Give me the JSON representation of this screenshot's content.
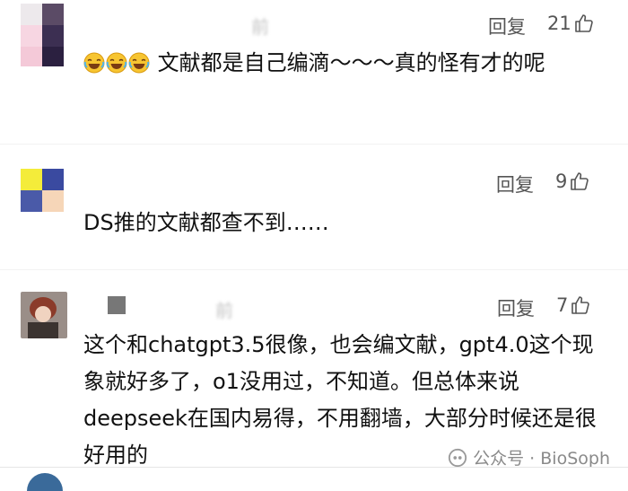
{
  "comments": [
    {
      "author": "",
      "time_fragment": "前",
      "reply_label": "回复",
      "likes": "21",
      "text": "文献都是自己编滴～～～真的怪有才的呢",
      "emoji_count": 3
    },
    {
      "author": "",
      "time_fragment": "",
      "reply_label": "回复",
      "likes": "9",
      "text": "DS推的文献都查不到……"
    },
    {
      "author": "",
      "time_fragment": "前",
      "reply_label": "回复",
      "likes": "7",
      "text": "这个和chatgpt3.5很像，也会编文献，gpt4.0这个现象就好多了，o1没用过，不知道。但总体来说deepseek在国内易得，不用翻墙，大部分时候还是很好用的"
    }
  ],
  "watermark": {
    "text": "公众号 · BioSoph",
    "icon": "wechat-official-account-icon"
  },
  "icons": {
    "like": "thumbs-up-icon",
    "emoji": "laugh-tears-emoji"
  }
}
